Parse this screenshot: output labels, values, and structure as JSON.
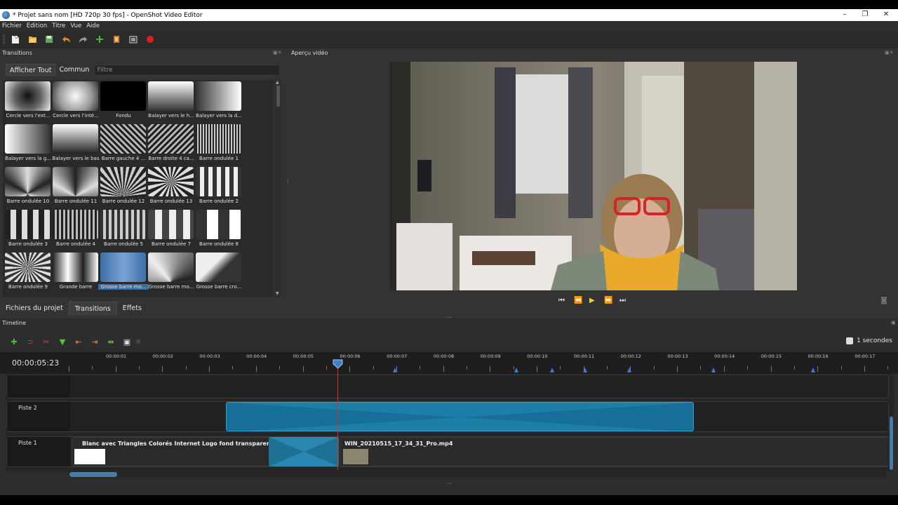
{
  "window": {
    "title": "* Projet sans nom [HD 720p 30 fps] - OpenShot Video Editor",
    "min_glyph": "–",
    "max_glyph": "❐",
    "close_glyph": "✕"
  },
  "menu": [
    "Fichier",
    "Edition",
    "Titre",
    "Vue",
    "Aide"
  ],
  "toolbar": {
    "icons": [
      "new-project-icon",
      "open-project-icon",
      "save-project-icon",
      "undo-icon",
      "redo-icon",
      "import-files-icon",
      "profile-icon",
      "fullscreen-icon",
      "export-icon"
    ]
  },
  "transitions_panel": {
    "title": "Transitions",
    "filter_tabs": [
      "Afficher Tout",
      "Commun"
    ],
    "filter_placeholder": "Filtre",
    "items": [
      {
        "label": "Cercle vers l'ext..."
      },
      {
        "label": "Cercle vers l'inté..."
      },
      {
        "label": "Fondu"
      },
      {
        "label": "Balayer vers le h..."
      },
      {
        "label": "Balayer vers la d..."
      },
      {
        "label": "Balayer vers la g..."
      },
      {
        "label": "Balayer vers le bas"
      },
      {
        "label": "Barre gauche 4 ..."
      },
      {
        "label": "Barre droite 4 ca..."
      },
      {
        "label": "Barre ondulée 1"
      },
      {
        "label": "Barre ondulée 10"
      },
      {
        "label": "Barre ondulée 11"
      },
      {
        "label": "Barre ondulée 12"
      },
      {
        "label": "Barre ondulée 13"
      },
      {
        "label": "Barre ondulée 2"
      },
      {
        "label": "Barre ondulée 3"
      },
      {
        "label": "Barre ondulée 4"
      },
      {
        "label": "Barre ondulée 5"
      },
      {
        "label": "Barre ondulée 7"
      },
      {
        "label": "Barre ondulée 8"
      },
      {
        "label": "Barre ondulée 9"
      },
      {
        "label": "Grande barre"
      },
      {
        "label": "Grosse barre mo..."
      },
      {
        "label": "Grosse barre mo..."
      },
      {
        "label": "Grosse barre cro..."
      }
    ],
    "selected_index": 22,
    "bottom_tabs": [
      "Fichiers du projet",
      "Transitions",
      "Effets"
    ],
    "active_bottom_tab": "Transitions"
  },
  "preview": {
    "title": "Aperçu vidéo",
    "controls": [
      "jump-start-icon",
      "rewind-icon",
      "play-icon",
      "fast-forward-icon",
      "jump-end-icon"
    ]
  },
  "timeline": {
    "title": "Timeline",
    "timecode": "00:00:05:23",
    "zoom_label": "1 secondes",
    "ruler_labels": [
      "00:00:01",
      "00:00:02",
      "00:00:03",
      "00:00:04",
      "00:00:05",
      "00:00:06",
      "00:00:07",
      "00:00:08",
      "00:00:09",
      "00:00:10",
      "00:00:11",
      "00:00:12",
      "00:00:13",
      "00:00:14",
      "00:00:15",
      "00:00:16",
      "00:00:17"
    ],
    "tracks": [
      {
        "name": ""
      },
      {
        "name": "Piste 2"
      },
      {
        "name": "Piste 1"
      }
    ],
    "clips": {
      "image_clip": "Blanc avec Triangles Colorés Internet Logo fond transparent.jpg",
      "video_clip": "WIN_20210515_17_34_31_Pro.mp4"
    }
  }
}
